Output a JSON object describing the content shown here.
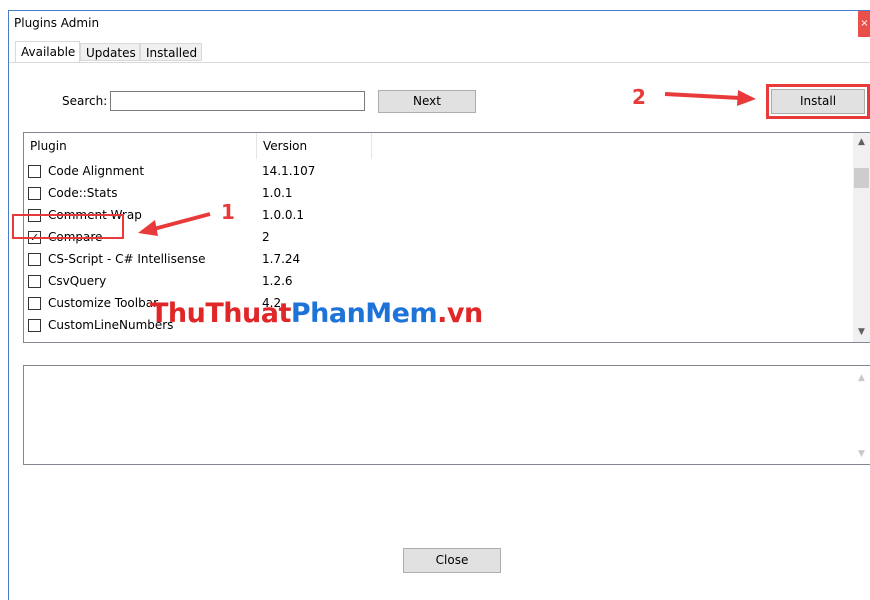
{
  "window": {
    "title": "Plugins Admin",
    "close_glyph": "×"
  },
  "tabs": [
    {
      "label": "Available",
      "active": true
    },
    {
      "label": "Updates",
      "active": false
    },
    {
      "label": "Installed",
      "active": false
    }
  ],
  "search": {
    "label": "Search:",
    "value": "",
    "next_label": "Next"
  },
  "install_label": "Install",
  "list": {
    "columns": [
      "Plugin",
      "Version"
    ],
    "rows": [
      {
        "name": "Code Alignment",
        "version": "14.1.107",
        "checked": false
      },
      {
        "name": "Code::Stats",
        "version": "1.0.1",
        "checked": false
      },
      {
        "name": "Comment Wrap",
        "version": "1.0.0.1",
        "checked": false
      },
      {
        "name": "Compare",
        "version": "2",
        "checked": true
      },
      {
        "name": "CS-Script - C# Intellisense",
        "version": "1.7.24",
        "checked": false
      },
      {
        "name": "CsvQuery",
        "version": "1.2.6",
        "checked": false
      },
      {
        "name": "Customize Toolbar",
        "version": "4.2",
        "checked": false
      },
      {
        "name": "CustomLineNumbers",
        "version": "",
        "checked": false
      }
    ]
  },
  "description": "",
  "close_label": "Close",
  "annotations": {
    "step1": "1",
    "step2": "2"
  },
  "watermark": {
    "part1": "ThuThuat",
    "part2": "PhanMem",
    "part3": ".vn"
  },
  "colors": {
    "accent": "#e83a3a",
    "watermark_red": "#e02626",
    "watermark_blue": "#1e73d8"
  }
}
